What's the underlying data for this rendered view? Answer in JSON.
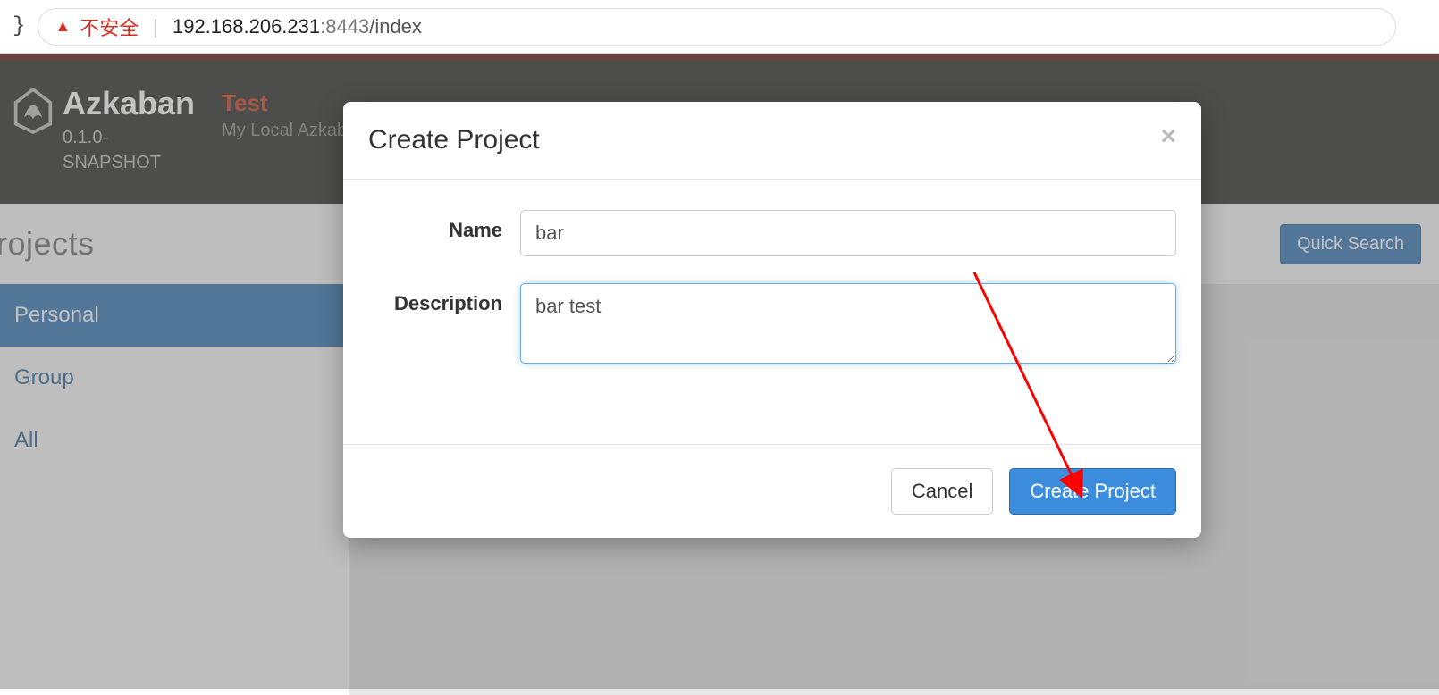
{
  "browser": {
    "not_secure_text": "不安全",
    "url_host": "192.168.206.231",
    "url_port": ":8443",
    "url_path": "/index"
  },
  "header": {
    "brand": "Azkaban",
    "version_line1": "0.1.0-",
    "version_line2": "SNAPSHOT",
    "env_name": "Test",
    "env_sub": "My Local Azkaba"
  },
  "page": {
    "title": "rojects",
    "quick_search": "Quick Search"
  },
  "sidebar": {
    "items": [
      {
        "label": "Personal",
        "active": true
      },
      {
        "label": "Group",
        "active": false
      },
      {
        "label": "All",
        "active": false
      }
    ]
  },
  "modal": {
    "title": "Create Project",
    "name_label": "Name",
    "name_value": "bar",
    "desc_label": "Description",
    "desc_value": "bar test",
    "cancel": "Cancel",
    "submit": "Create Project"
  }
}
